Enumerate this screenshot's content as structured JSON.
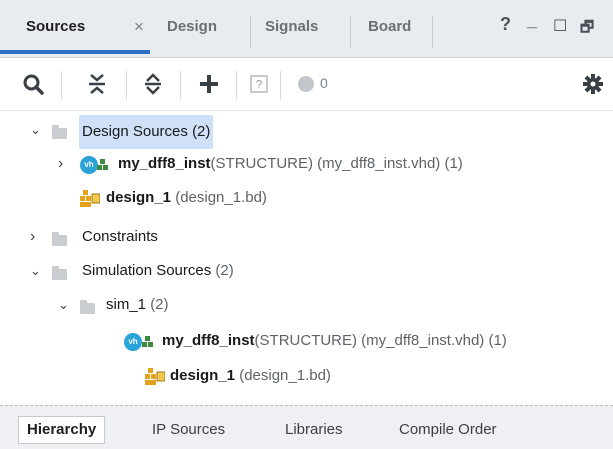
{
  "tabs": {
    "sources": "Sources",
    "close": "×",
    "design": "Design",
    "signals": "Signals",
    "board": "Board"
  },
  "window_controls": {
    "help": "?",
    "minimize": "_",
    "maximize": "☐",
    "restore": "🗗"
  },
  "toolbar": {
    "error_count": "0",
    "unknown": "?"
  },
  "tree": {
    "design_sources": {
      "label": "Design Sources",
      "count": "(2)"
    },
    "ds_item1": {
      "name": "my_dff8_inst",
      "detail": "(STRUCTURE) (my_dff8_inst.vhd) (1)"
    },
    "ds_item2": {
      "name": "design_1",
      "detail": "(design_1.bd)"
    },
    "constraints": {
      "label": "Constraints"
    },
    "simulation_sources": {
      "label": "Simulation Sources",
      "count": "(2)"
    },
    "sim_1": {
      "label": "sim_1",
      "count": "(2)"
    },
    "sim_item1": {
      "name": "my_dff8_inst",
      "detail": "(STRUCTURE) (my_dff8_inst.vhd) (1)"
    },
    "sim_item2": {
      "name": "design_1",
      "detail": "(design_1.bd)"
    }
  },
  "bottom_tabs": {
    "hierarchy": "Hierarchy",
    "ip_sources": "IP Sources",
    "libraries": "Libraries",
    "compile_order": "Compile Order"
  },
  "colors": {
    "accent": "#2f6fc2",
    "selection": "#cfe0f8",
    "vhdl_icon": "#2aa3d8",
    "bd_icon": "#e3a21a",
    "gear": "#3a3f45"
  },
  "icons": {
    "search": "search-icon",
    "collapse_all": "collapse-all-icon",
    "expand_all": "expand-all-icon",
    "add": "add-icon",
    "unknown": "question-icon",
    "status": "circle-status-icon",
    "settings": "gear-icon"
  }
}
